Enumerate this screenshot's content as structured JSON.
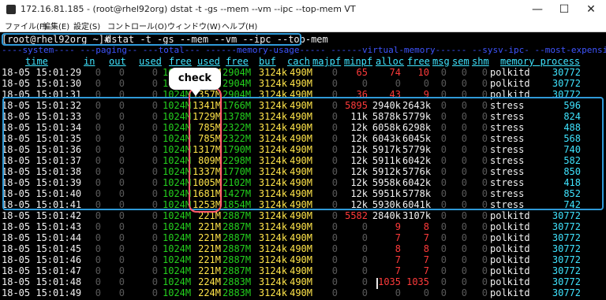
{
  "window": {
    "title": "172.16.81.185 - (root@rhel92org) dstat -t -gs --mem --vm --ipc --top-mem VT",
    "buttons": {
      "minimize": "—",
      "maximize": "☐",
      "close": "✕"
    }
  },
  "menu": [
    "ファイル(F)",
    "編集(E)",
    "設定(S)",
    "コントロール(O)",
    "ウィンドウ(W)",
    "ヘルプ(H)"
  ],
  "terminal": {
    "prompt": "[root@rhel92org ~]# ",
    "command": "dstat -t -gs --mem --vm --ipc --top-mem",
    "group_header": "----system---- ---paging-- ---total--- ------memory-usage----- ------virtual-memory------ --sysv-ipc- --most-expensive-",
    "subheaders": {
      "time": "time",
      "in": "in",
      "out": "out",
      "used": "used",
      "free": "free",
      "used2": "used",
      "free2": "free",
      "buf": "buf",
      "cach": "cach",
      "majpf": "majpf",
      "minpf": "minpf",
      "alloc": "alloc",
      "free3": "free",
      "msg": "msg",
      "sem": "sem",
      "shm": "shm",
      "memory_process": "memory process"
    },
    "rows": [
      {
        "time": "18-05 15:01:29",
        "in": "0",
        "out": "0",
        "used": "0",
        "free": "1024M",
        "mused": "1357M",
        "mfree": "2904M",
        "buf": "3124k",
        "cach": "490M",
        "majpf": "0",
        "minpf": "65",
        "alloc": "74",
        "vfree": "10",
        "msg": "0",
        "sem": "0",
        "shm": "0",
        "proc": "polkitd",
        "pmem": "30772"
      },
      {
        "time": "18-05 15:01:30",
        "in": "0",
        "out": "0",
        "used": "0",
        "free": "1024M",
        "mused": "1357M",
        "mfree": "2904M",
        "buf": "3124k",
        "cach": "490M",
        "majpf": "0",
        "minpf": "0",
        "alloc": "0",
        "vfree": "0",
        "msg": "0",
        "sem": "0",
        "shm": "0",
        "proc": "polkitd",
        "pmem": "30772"
      },
      {
        "time": "18-05 15:01:31",
        "in": "0",
        "out": "0",
        "used": "0",
        "free": "1024M",
        "mused": "1357M",
        "mfree": "2904M",
        "buf": "3124k",
        "cach": "490M",
        "majpf": "0",
        "minpf": "36",
        "alloc": "43",
        "vfree": "9",
        "msg": "0",
        "sem": "0",
        "shm": "0",
        "proc": "polkitd",
        "pmem": "30772"
      },
      {
        "time": "18-05 15:01:32",
        "in": "0",
        "out": "0",
        "used": "0",
        "free": "1024M",
        "mused": "1341M",
        "mfree": "1766M",
        "buf": "3124k",
        "cach": "490M",
        "majpf": "0",
        "minpf": "5895",
        "alloc": "2940k",
        "vfree": "2643k",
        "msg": "0",
        "sem": "0",
        "shm": "0",
        "proc": "stress",
        "pmem": "596"
      },
      {
        "time": "18-05 15:01:33",
        "in": "0",
        "out": "0",
        "used": "0",
        "free": "1024M",
        "mused": "1729M",
        "mfree": "1378M",
        "buf": "3124k",
        "cach": "490M",
        "majpf": "0",
        "minpf": "11k",
        "alloc": "5878k",
        "vfree": "5779k",
        "msg": "0",
        "sem": "0",
        "shm": "0",
        "proc": "stress",
        "pmem": "824"
      },
      {
        "time": "18-05 15:01:34",
        "in": "0",
        "out": "0",
        "used": "0",
        "free": "1024M",
        "mused": "785M",
        "mfree": "2322M",
        "buf": "3124k",
        "cach": "490M",
        "majpf": "0",
        "minpf": "12k",
        "alloc": "6058k",
        "vfree": "6298k",
        "msg": "0",
        "sem": "0",
        "shm": "0",
        "proc": "stress",
        "pmem": "488"
      },
      {
        "time": "18-05 15:01:35",
        "in": "0",
        "out": "0",
        "used": "0",
        "free": "1024M",
        "mused": "785M",
        "mfree": "2322M",
        "buf": "3124k",
        "cach": "490M",
        "majpf": "0",
        "minpf": "12k",
        "alloc": "6043k",
        "vfree": "6045k",
        "msg": "0",
        "sem": "0",
        "shm": "0",
        "proc": "stress",
        "pmem": "568"
      },
      {
        "time": "18-05 15:01:36",
        "in": "0",
        "out": "0",
        "used": "0",
        "free": "1024M",
        "mused": "1317M",
        "mfree": "1790M",
        "buf": "3124k",
        "cach": "490M",
        "majpf": "0",
        "minpf": "12k",
        "alloc": "5917k",
        "vfree": "5779k",
        "msg": "0",
        "sem": "0",
        "shm": "0",
        "proc": "stress",
        "pmem": "740"
      },
      {
        "time": "18-05 15:01:37",
        "in": "0",
        "out": "0",
        "used": "0",
        "free": "1024M",
        "mused": "809M",
        "mfree": "2298M",
        "buf": "3124k",
        "cach": "490M",
        "majpf": "0",
        "minpf": "12k",
        "alloc": "5911k",
        "vfree": "6042k",
        "msg": "0",
        "sem": "0",
        "shm": "0",
        "proc": "stress",
        "pmem": "582"
      },
      {
        "time": "18-05 15:01:38",
        "in": "0",
        "out": "0",
        "used": "0",
        "free": "1024M",
        "mused": "1337M",
        "mfree": "1770M",
        "buf": "3124k",
        "cach": "490M",
        "majpf": "0",
        "minpf": "12k",
        "alloc": "5912k",
        "vfree": "5776k",
        "msg": "0",
        "sem": "0",
        "shm": "0",
        "proc": "stress",
        "pmem": "850"
      },
      {
        "time": "18-05 15:01:39",
        "in": "0",
        "out": "0",
        "used": "0",
        "free": "1024M",
        "mused": "1005M",
        "mfree": "2102M",
        "buf": "3124k",
        "cach": "490M",
        "majpf": "0",
        "minpf": "12k",
        "alloc": "5958k",
        "vfree": "6042k",
        "msg": "0",
        "sem": "0",
        "shm": "0",
        "proc": "stress",
        "pmem": "418"
      },
      {
        "time": "18-05 15:01:40",
        "in": "0",
        "out": "0",
        "used": "0",
        "free": "1024M",
        "mused": "1681M",
        "mfree": "1427M",
        "buf": "3124k",
        "cach": "490M",
        "majpf": "0",
        "minpf": "12k",
        "alloc": "5951k",
        "vfree": "5778k",
        "msg": "0",
        "sem": "0",
        "shm": "0",
        "proc": "stress",
        "pmem": "852"
      },
      {
        "time": "18-05 15:01:41",
        "in": "0",
        "out": "0",
        "used": "0",
        "free": "1024M",
        "mused": "1253M",
        "mfree": "1854M",
        "buf": "3124k",
        "cach": "490M",
        "majpf": "0",
        "minpf": "12k",
        "alloc": "5930k",
        "vfree": "6041k",
        "msg": "0",
        "sem": "0",
        "shm": "0",
        "proc": "stress",
        "pmem": "742"
      },
      {
        "time": "18-05 15:01:42",
        "in": "0",
        "out": "0",
        "used": "0",
        "free": "1024M",
        "mused": "221M",
        "mfree": "2887M",
        "buf": "3124k",
        "cach": "490M",
        "majpf": "0",
        "minpf": "5582",
        "alloc": "2840k",
        "vfree": "3107k",
        "msg": "0",
        "sem": "0",
        "shm": "0",
        "proc": "polkitd",
        "pmem": "30772"
      },
      {
        "time": "18-05 15:01:43",
        "in": "0",
        "out": "0",
        "used": "0",
        "free": "1024M",
        "mused": "221M",
        "mfree": "2887M",
        "buf": "3124k",
        "cach": "490M",
        "majpf": "0",
        "minpf": "0",
        "alloc": "9",
        "vfree": "8",
        "msg": "0",
        "sem": "0",
        "shm": "0",
        "proc": "polkitd",
        "pmem": "30772"
      },
      {
        "time": "18-05 15:01:44",
        "in": "0",
        "out": "0",
        "used": "0",
        "free": "1024M",
        "mused": "221M",
        "mfree": "2887M",
        "buf": "3124k",
        "cach": "490M",
        "majpf": "0",
        "minpf": "0",
        "alloc": "7",
        "vfree": "7",
        "msg": "0",
        "sem": "0",
        "shm": "0",
        "proc": "polkitd",
        "pmem": "30772"
      },
      {
        "time": "18-05 15:01:45",
        "in": "0",
        "out": "0",
        "used": "0",
        "free": "1024M",
        "mused": "221M",
        "mfree": "2887M",
        "buf": "3124k",
        "cach": "490M",
        "majpf": "0",
        "minpf": "0",
        "alloc": "8",
        "vfree": "8",
        "msg": "0",
        "sem": "0",
        "shm": "0",
        "proc": "polkitd",
        "pmem": "30772"
      },
      {
        "time": "18-05 15:01:46",
        "in": "0",
        "out": "0",
        "used": "0",
        "free": "1024M",
        "mused": "221M",
        "mfree": "2887M",
        "buf": "3124k",
        "cach": "490M",
        "majpf": "0",
        "minpf": "0",
        "alloc": "7",
        "vfree": "7",
        "msg": "0",
        "sem": "0",
        "shm": "0",
        "proc": "polkitd",
        "pmem": "30772"
      },
      {
        "time": "18-05 15:01:47",
        "in": "0",
        "out": "0",
        "used": "0",
        "free": "1024M",
        "mused": "221M",
        "mfree": "2887M",
        "buf": "3124k",
        "cach": "490M",
        "majpf": "0",
        "minpf": "0",
        "alloc": "7",
        "vfree": "7",
        "msg": "0",
        "sem": "0",
        "shm": "0",
        "proc": "polkitd",
        "pmem": "30772"
      },
      {
        "time": "18-05 15:01:48",
        "in": "0",
        "out": "0",
        "used": "0",
        "free": "1024M",
        "mused": "224M",
        "mfree": "2883M",
        "buf": "3124k",
        "cach": "490M",
        "majpf": "0",
        "minpf": "0",
        "alloc": "1035",
        "vfree": "1035",
        "msg": "0",
        "sem": "0",
        "shm": "0",
        "proc": "polkitd",
        "pmem": "30772"
      },
      {
        "time": "18-05 15:01:49",
        "in": "0",
        "out": "0",
        "used": "0",
        "free": "1024M",
        "mused": "224M",
        "mfree": "2883M",
        "buf": "3124k",
        "cach": "490M",
        "majpf": "0",
        "minpf": "0",
        "alloc": "0",
        "vfree": "0",
        "msg": "0",
        "sem": "0",
        "shm": "0",
        "proc": "polkitd",
        "pmem": "30772"
      }
    ]
  },
  "annotation": {
    "callout": "check"
  },
  "colors": {
    "accent_box": "#2f9ad8",
    "check_box": "#ff5b6b",
    "bg": "#000000",
    "header_blue": "#3f55ff",
    "subheader_cyan": "#3fe4ff"
  }
}
